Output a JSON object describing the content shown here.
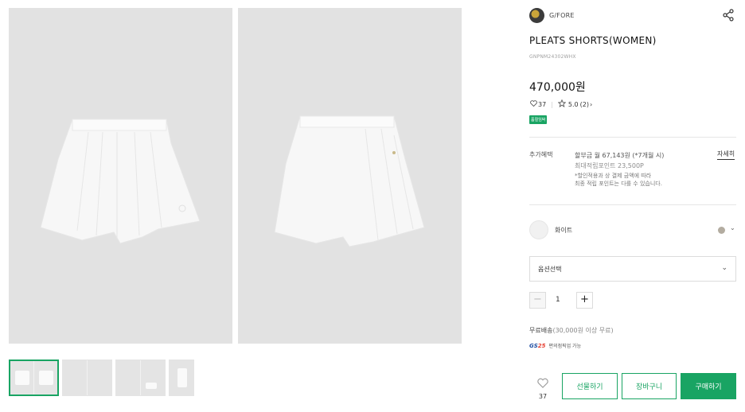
{
  "product": {
    "brand": "G/FORE",
    "title": "PLEATS SHORTS(WOMEN)",
    "code": "GNPNM24302WHX",
    "price": "470,000원",
    "wish_count": "37",
    "rating": "5.0",
    "review_count": "(2)",
    "badge": "품절임박"
  },
  "benefits": {
    "label": "추가혜택",
    "installment": "할부금 월 67,143원 (*7개월 시)",
    "points": "최대적립포인트 23,500P",
    "note_line1": "*할인적용과 상 결제 금액에 따라",
    "note_line2": "최종 적립 포인트는 다를 수 있습니다.",
    "detail_link": "자세히"
  },
  "option": {
    "color_name": "화이트",
    "color_hex": "#b3aca0",
    "select_label": "옵션선택",
    "quantity": "1"
  },
  "shipping": {
    "text": "무료배송",
    "note": "(30,000원 이상 무료)",
    "pickup_logo": "GS25",
    "pickup_text": "편의점픽업 가능"
  },
  "actions": {
    "wish_count": "37",
    "gift": "선물하기",
    "cart": "장바구니",
    "buy": "구매하기"
  },
  "colors": {
    "accent": "#19a463",
    "image_bg": "#e2e2e2"
  }
}
